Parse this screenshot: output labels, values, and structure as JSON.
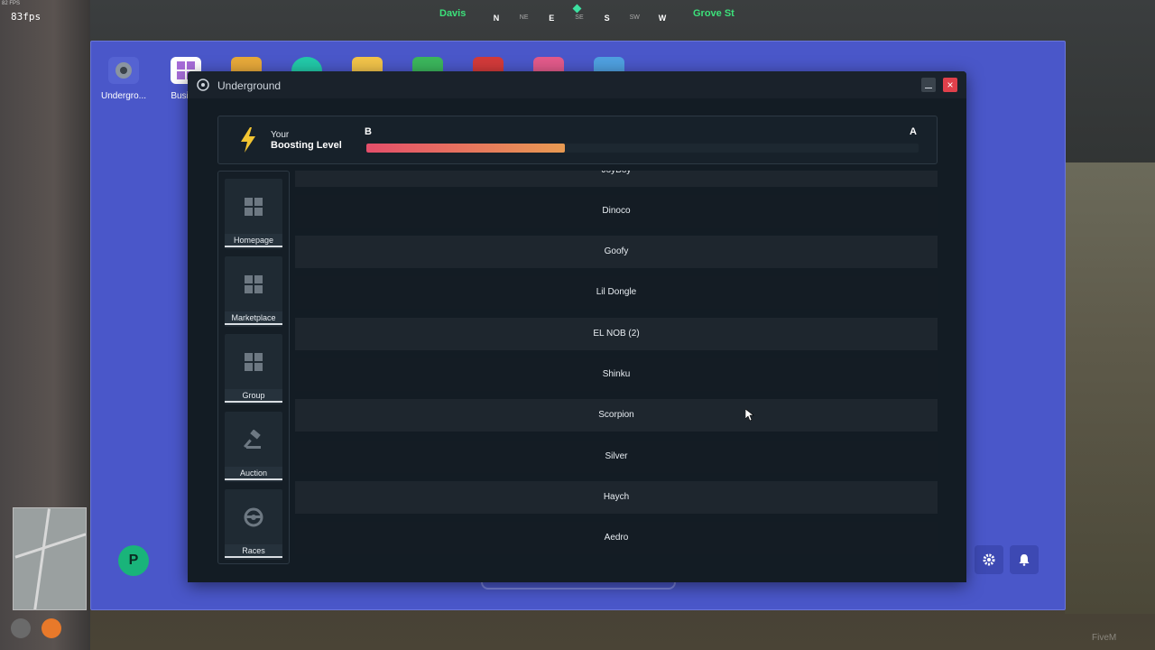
{
  "hud": {
    "fps_small": "82 FPS",
    "fps": "83fps",
    "compass": {
      "street_left": "Davis",
      "street_right": "Grove St",
      "directions": [
        "N",
        "NE",
        "E",
        "SE",
        "S",
        "SW",
        "W"
      ]
    },
    "watermark": "FiveM"
  },
  "desktop": {
    "icons": [
      {
        "label": "Undergro..."
      },
      {
        "label": "Busin..."
      }
    ]
  },
  "window": {
    "title": "Underground",
    "close_label": "×"
  },
  "boosting": {
    "your_label": "Your",
    "level_label": "Boosting Level",
    "current_grade": "B",
    "next_grade": "A",
    "progress": 0.36
  },
  "sidebar": {
    "items": [
      {
        "label": "Homepage",
        "icon": "grid-icon"
      },
      {
        "label": "Marketplace",
        "icon": "grid-icon"
      },
      {
        "label": "Group",
        "icon": "grid-icon"
      },
      {
        "label": "Auction",
        "icon": "gavel-icon"
      },
      {
        "label": "Races",
        "icon": "steering-wheel-icon"
      }
    ]
  },
  "contracts": {
    "rows": [
      "JoyBoy",
      "Dinoco",
      "Goofy",
      "Lil Dongle",
      "EL NOB (2)",
      "Shinku",
      "Scorpion",
      "Silver",
      "Haych",
      "Aedro"
    ]
  },
  "dock": {
    "logo_letter": "P"
  },
  "colors": {
    "tablet": "#4a57c9",
    "window_bg": "#131c24",
    "progress_start": "#e44e6a",
    "progress_end": "#e89a52",
    "street_name": "#3ce07a",
    "close": "#e0404b"
  }
}
